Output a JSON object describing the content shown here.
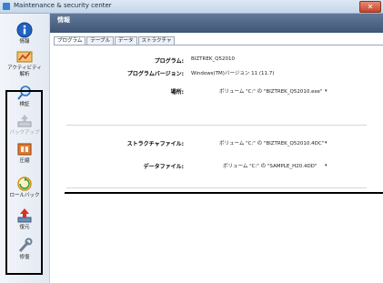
{
  "window": {
    "title": "Maintenance & security center"
  },
  "sidebar": {
    "items": [
      {
        "label": "情報",
        "icon": "info-icon"
      },
      {
        "label": "アクティビティ\n解析",
        "icon": "activity-icon"
      },
      {
        "label": "検証",
        "icon": "verify-icon"
      },
      {
        "label": "バックアップ",
        "icon": "backup-icon",
        "disabled": true
      },
      {
        "label": "圧縮",
        "icon": "compress-icon"
      },
      {
        "label": "ロールバック",
        "icon": "rollback-icon"
      },
      {
        "label": "復元",
        "icon": "restore-icon"
      },
      {
        "label": "修復",
        "icon": "repair-icon"
      }
    ]
  },
  "header": {
    "title": "情報"
  },
  "tabs": [
    "プログラム",
    "テーブル",
    "データ",
    "ストラクチャ"
  ],
  "info": {
    "program_label": "プログラム:",
    "program_value": "BIZTREK_Q52010",
    "version_label": "プログラムバージョン:",
    "version_value": "Windows(TM)バージョン 11 (11.7)",
    "location_label": "場所:",
    "location_value": "ボリューム \"C:\" の \"BIZTREK_Q52010.exe\"",
    "structure_label": "ストラクチャファイル:",
    "structure_value": "ボリューム \"C:\" の \"BIZTREK_Q52010.4DC\"",
    "data_label": "データファイル:",
    "data_value": "ボリューム \"C:\" の \"SAMPLE_H20.4DD\""
  },
  "colors": {
    "header": "#4d6586",
    "highlight": "#000000"
  }
}
